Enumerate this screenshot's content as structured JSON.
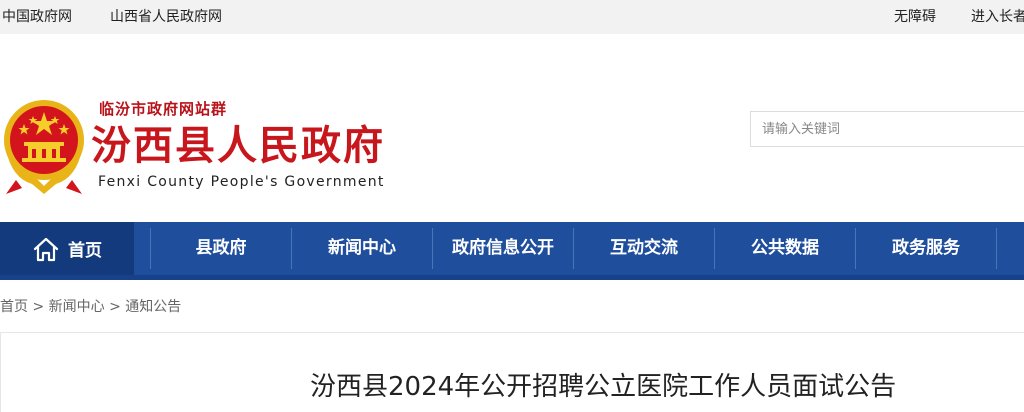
{
  "topbar": {
    "left_links": [
      "中国政府网",
      "山西省人民政府网"
    ],
    "right_links": [
      "无障碍",
      "进入长者模式"
    ]
  },
  "header": {
    "site_group": "临汾市政府网站群",
    "site_title": "汾西县人民政府",
    "site_title_en": "Fenxi County People's Government"
  },
  "search": {
    "placeholder": "请输入关键词"
  },
  "nav": {
    "home": "首页",
    "items": [
      "县政府",
      "新闻中心",
      "政府信息公开",
      "互动交流",
      "公共数据",
      "政务服务"
    ]
  },
  "breadcrumb": {
    "items": [
      "首页",
      "新闻中心",
      "通知公告"
    ],
    "separator": ">"
  },
  "article": {
    "title": "汾西县2024年公开招聘公立医院工作人员面试公告"
  },
  "colors": {
    "nav_blue": "#1f4e9c",
    "nav_active": "#123a7c",
    "title_red": "#c8161d"
  },
  "icons": {
    "emblem": "national-emblem-icon",
    "home": "home-icon"
  }
}
